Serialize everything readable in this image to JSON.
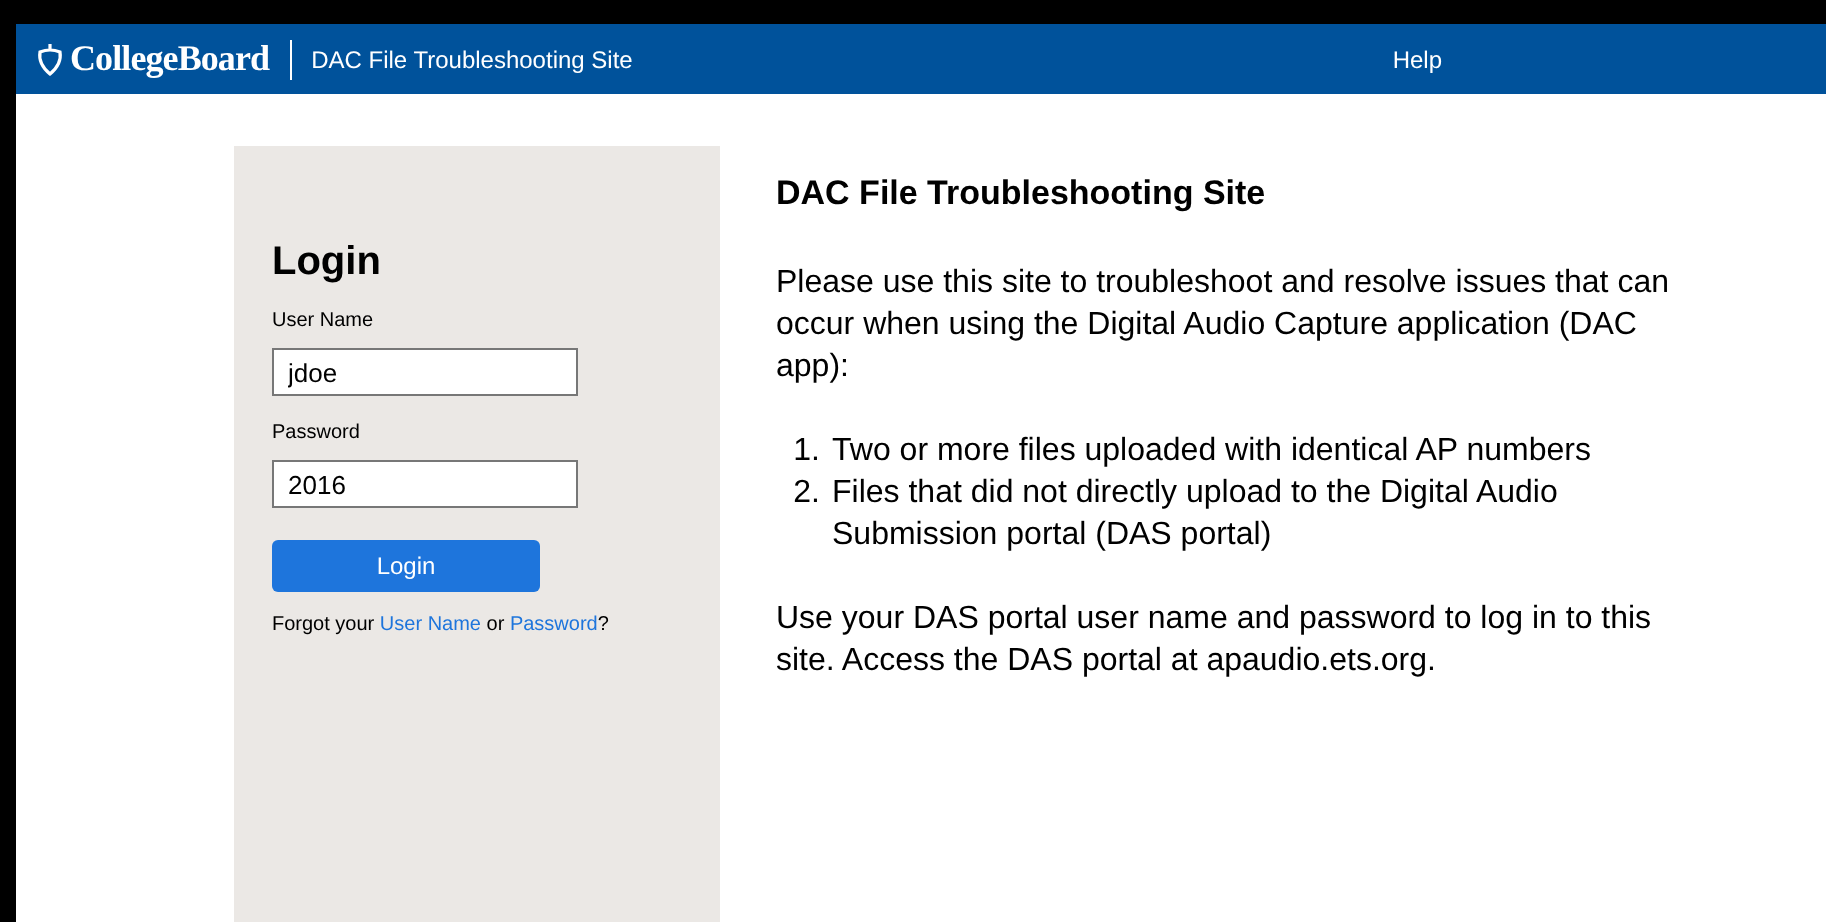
{
  "header": {
    "brand": "CollegeBoard",
    "site_title": "DAC File Troubleshooting Site",
    "help": "Help"
  },
  "login": {
    "title": "Login",
    "fields": [
      {
        "label": "User Name",
        "value": "jdoe"
      },
      {
        "label": "Password",
        "value": "2016"
      }
    ],
    "button": "Login",
    "forgot": {
      "before": "Forgot your",
      "link_1": "User Name",
      "middle": "or",
      "link_2": "Password",
      "after": "?"
    }
  },
  "content": {
    "title": "DAC File Troubleshooting Site",
    "intro": "Please use this site to troubleshoot and resolve issues that can occur when using the Digital Audio Capture application (DAC app):",
    "items": [
      {
        "number": "1.",
        "text": "Two or more files uploaded with identical AP numbers"
      },
      {
        "number": "2.",
        "text": "Files that did not directly upload to the Digital Audio Submission portal (DAS portal)"
      }
    ],
    "note": "Use your DAS portal user name and password to log in to this site. Access the DAS portal at apaudio.ets.org."
  }
}
